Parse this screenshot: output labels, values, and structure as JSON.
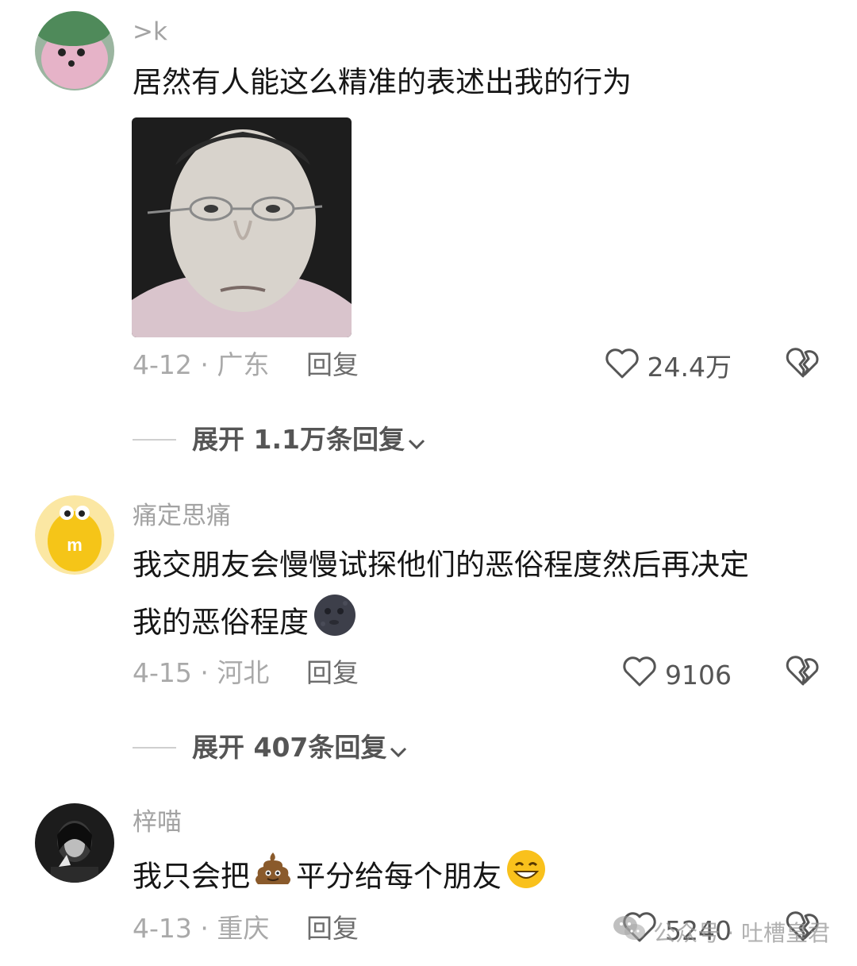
{
  "comments": [
    {
      "username": ">k",
      "text": "居然有人能这么精准的表述出我的行为",
      "date": "4-12",
      "location": "广东",
      "reply_label": "回复",
      "likes": "24.4万",
      "expand_label": "展开 1.1万条回复",
      "avatar_color": "#c9a9b6"
    },
    {
      "username": "痛定思痛",
      "text_line1": "我交朋友会慢慢试探他们的恶俗程度然后再决定",
      "text_line2": "我的恶俗程度",
      "date": "4-15",
      "location": "河北",
      "reply_label": "回复",
      "likes": "9106",
      "expand_label": "展开 407条回复",
      "avatar_color": "#f5c518"
    },
    {
      "username": "梓喵",
      "text_part1": "我只会把",
      "text_part2": "平分给每个朋友",
      "date": "4-13",
      "location": "重庆",
      "reply_label": "回复",
      "likes": "5240",
      "avatar_color": "#2a2a2a"
    }
  ],
  "watermark": {
    "text": "公众号 · 吐槽皇君"
  },
  "icons": {
    "like": "heart-outline-icon",
    "dislike": "broken-heart-icon",
    "expand": "chevron-down-icon"
  }
}
